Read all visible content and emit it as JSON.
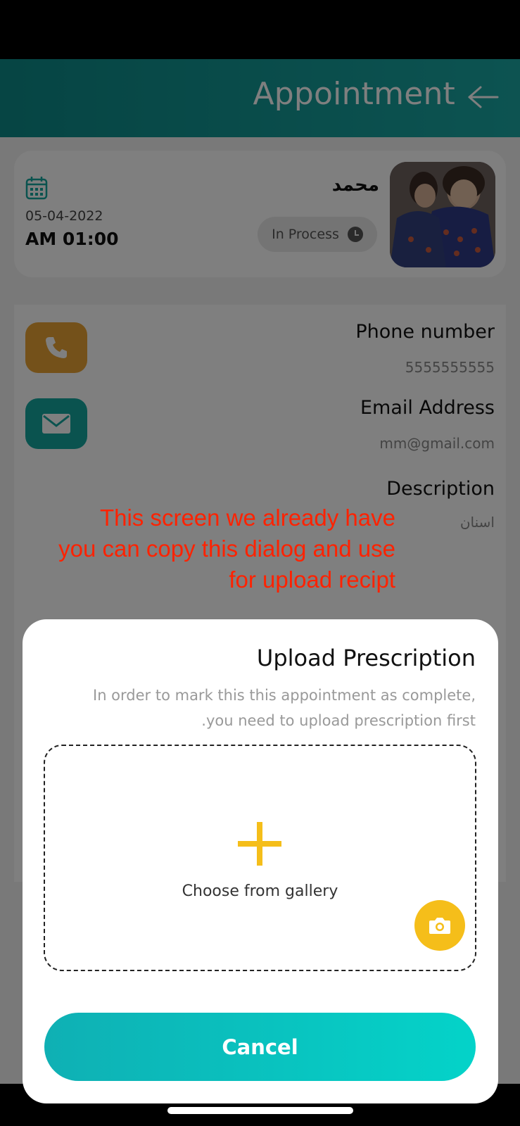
{
  "header": {
    "title": "Appointment",
    "back_icon": "arrow-right-icon"
  },
  "appointment": {
    "patient_name": "محمد",
    "status": "In Process",
    "date": "05-04-2022",
    "time": "AM 01:00"
  },
  "contact": {
    "phone_label": "Phone number",
    "phone_value": "5555555555",
    "email_label": "Email Address",
    "email_value": "mm@gmail.com",
    "description_label": "Description",
    "description_value": "اسنان"
  },
  "annotation": {
    "line1": "This screen we already have",
    "line2": "you can copy this dialog and use",
    "line3": "for upload recipt"
  },
  "dialog": {
    "title": "Upload Prescription",
    "desc_line1": "In order to mark this this appointment as complete,",
    "desc_line2": ".you need to upload prescription first",
    "gallery_label": "Choose from gallery",
    "cancel_label": "Cancel"
  },
  "colors": {
    "header": "#1aa7a3",
    "phone_button": "#e8a234",
    "mail_button": "#14a69e",
    "accent_yellow": "#f5be1a",
    "cancel_button": "#04d3c9",
    "annotation": "#ff2200"
  }
}
